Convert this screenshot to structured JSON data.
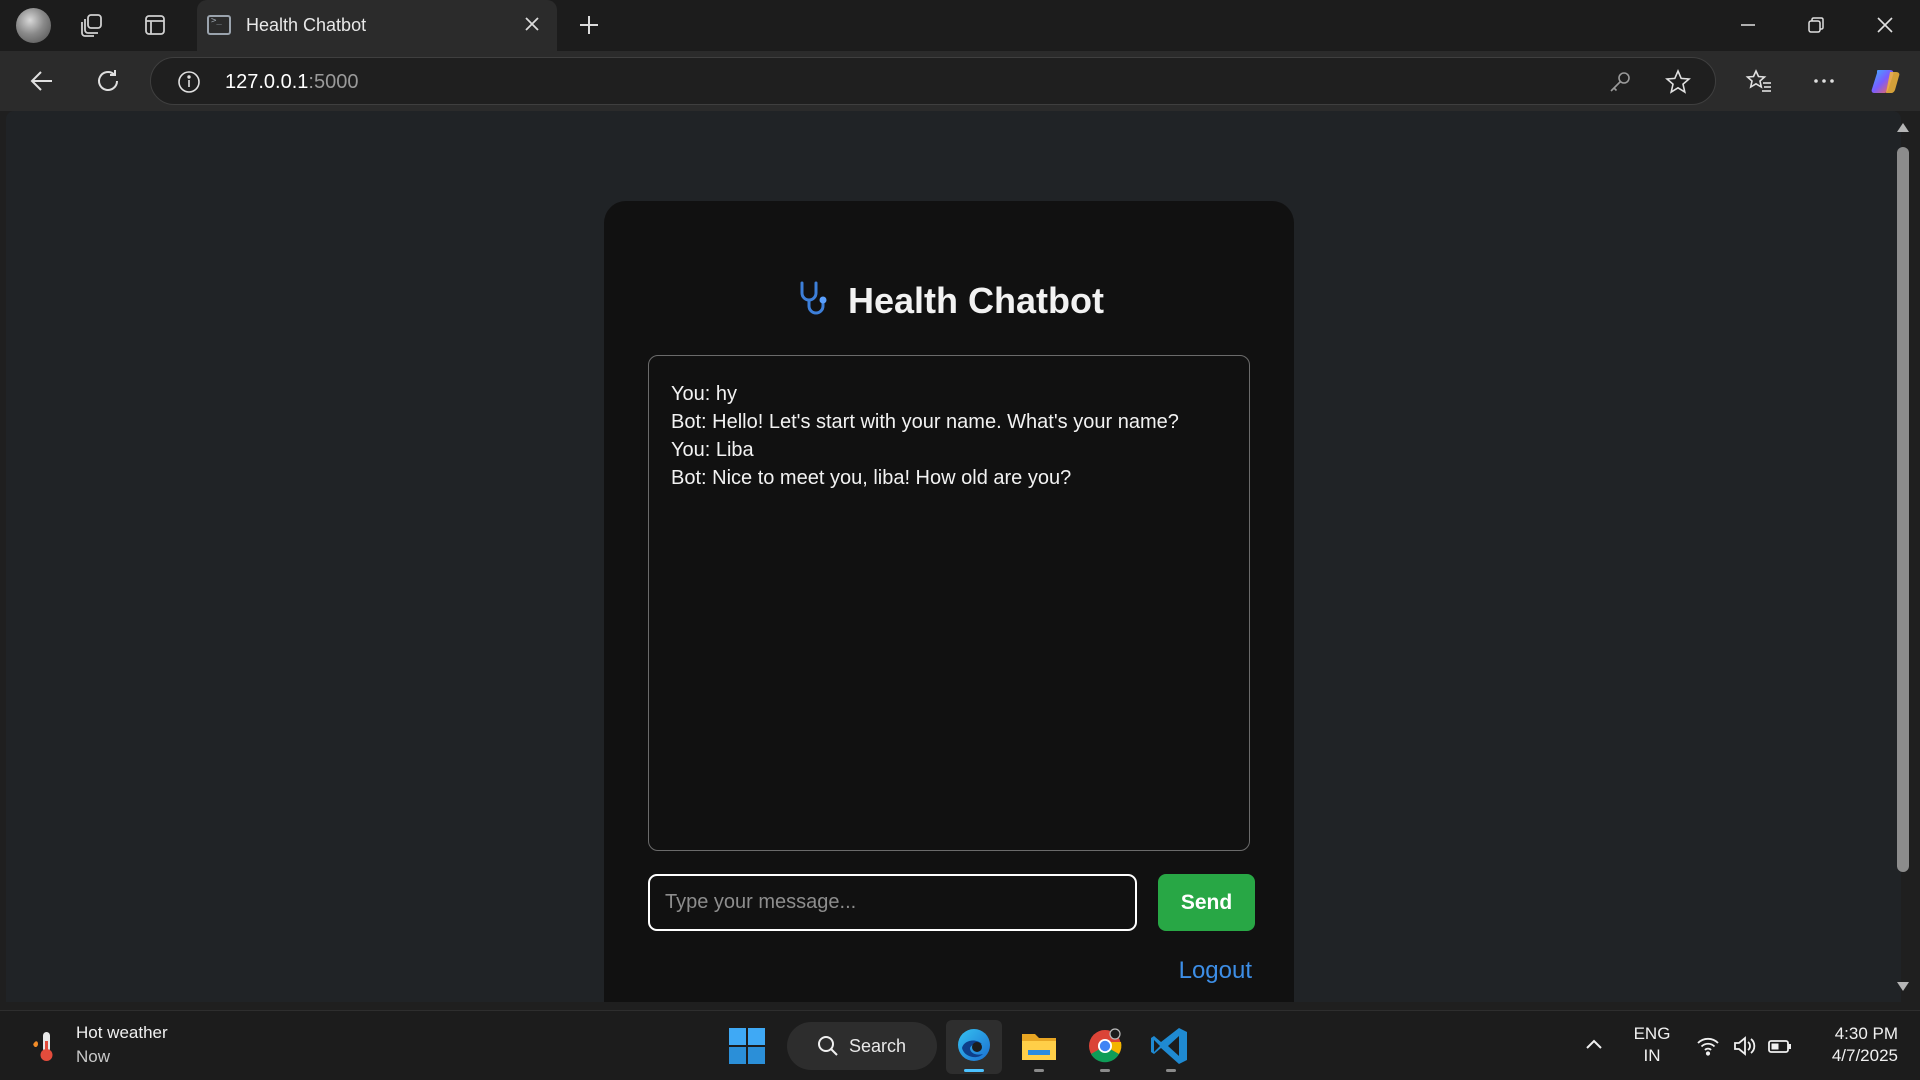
{
  "browser": {
    "tab_title": "Health Chatbot",
    "url_host": "127.0.0.1",
    "url_port": ":5000"
  },
  "page": {
    "title": "Health Chatbot",
    "messages": [
      "You: hy",
      "Bot: Hello! Let's start with your name. What's your name?",
      "You: Liba",
      "Bot: Nice to meet you, liba! How old are you?"
    ],
    "input_placeholder": "Type your message...",
    "send_label": "Send",
    "logout_label": "Logout",
    "colors": {
      "send": "#28a745",
      "logout": "#3d8ee6",
      "card": "#111111"
    }
  },
  "taskbar": {
    "weather_title": "Hot weather",
    "weather_sub": "Now",
    "search_label": "Search",
    "lang_line1": "ENG",
    "lang_line2": "IN",
    "time": "4:30 PM",
    "date": "4/7/2025",
    "apps": [
      "edge-icon",
      "file-explorer-icon",
      "chrome-icon",
      "vscode-icon"
    ]
  }
}
